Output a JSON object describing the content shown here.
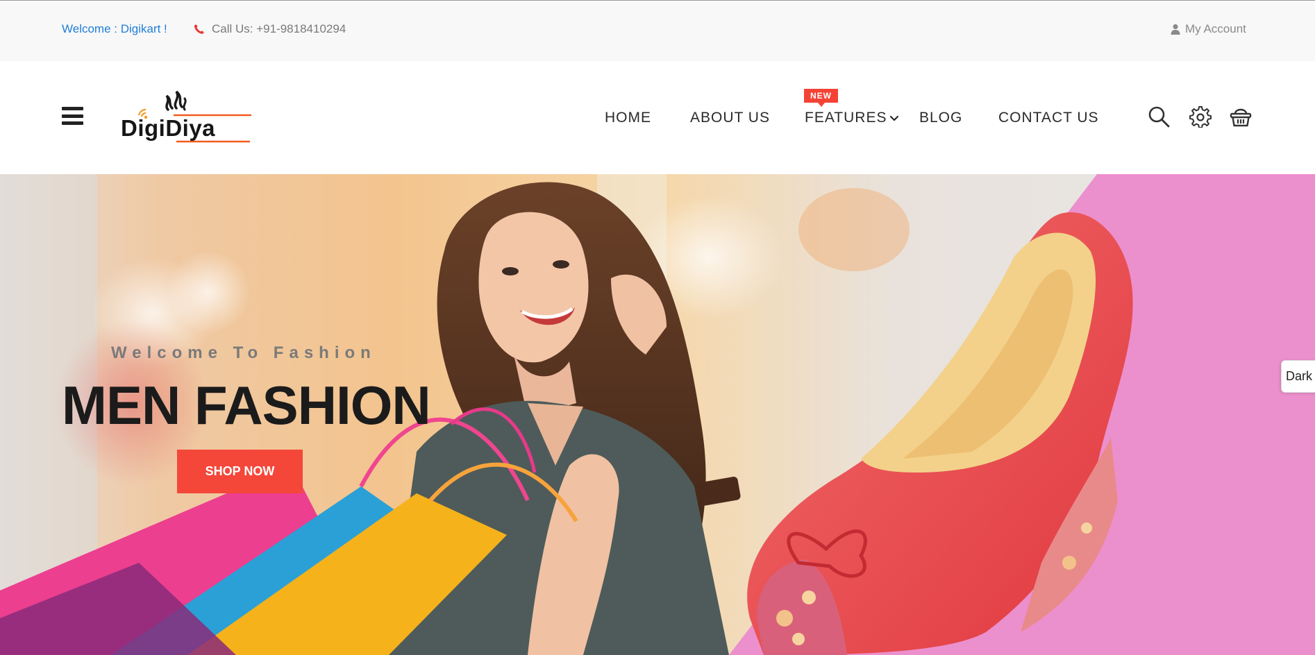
{
  "topbar": {
    "welcome": "Welcome : Digikart !",
    "call": "Call Us: +91-9818410294",
    "account": "My Account"
  },
  "header": {
    "logo_text": "DigiDiya",
    "nav": {
      "home": "HOME",
      "about": "ABOUT US",
      "features": "FEATURES",
      "features_badge": "NEW",
      "blog": "BLOG",
      "contact": "CONTACT US"
    }
  },
  "hero": {
    "subtitle": "Welcome To Fashion",
    "title": "MEN FASHION",
    "button": "SHOP NOW"
  },
  "theme_toggle": "Dark",
  "colors": {
    "accent": "#f4473a",
    "link": "#1f7fd8",
    "pink_panel": "#ec8fcd"
  }
}
